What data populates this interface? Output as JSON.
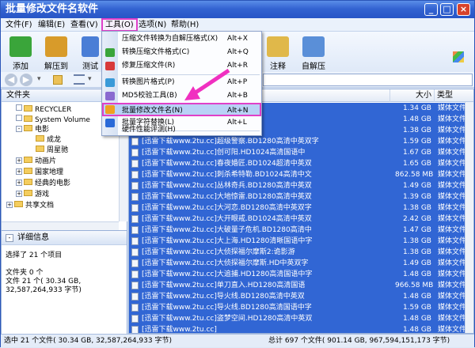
{
  "window": {
    "title": "批量修改文件名软件",
    "min_glyph": "_",
    "max_glyph": "□",
    "close_glyph": "×"
  },
  "menubar": {
    "items": [
      "文件(F)",
      "编辑(E)",
      "查看(V)",
      "工具(O)",
      "选项(N)",
      "帮助(H)"
    ]
  },
  "toolbar": {
    "buttons": [
      {
        "label": "添加",
        "icon": "add-archive-icon",
        "color": "#3aa53a"
      },
      {
        "label": "解压到",
        "icon": "extract-to-icon",
        "color": "#d89b2a"
      },
      {
        "label": "测试",
        "icon": "test-icon",
        "color": "#4a7ed6"
      },
      {
        "label": "注释",
        "icon": "comment-icon",
        "color": "#e0b84a"
      },
      {
        "label": "自解压",
        "icon": "sfx-icon",
        "color": "#5a8fd8"
      }
    ]
  },
  "navbar": {
    "back_icon": "back-arrow-icon",
    "forward_icon": "forward-arrow-icon"
  },
  "left_panel": {
    "title": "文件夹",
    "tree": [
      {
        "label": "RECYCLER",
        "expander": "",
        "depth": 2
      },
      {
        "label": "System Volume",
        "expander": "",
        "depth": 2
      },
      {
        "label": "电影",
        "expander": "-",
        "depth": 2
      },
      {
        "label": "成龙",
        "expander": "",
        "depth": 3
      },
      {
        "label": "周星驰",
        "expander": "",
        "depth": 3
      },
      {
        "label": "动画片",
        "expander": "+",
        "depth": 2
      },
      {
        "label": "国家地理",
        "expander": "+",
        "depth": 2
      },
      {
        "label": "经典的电影",
        "expander": "+",
        "depth": 2
      },
      {
        "label": "游戏",
        "expander": "+",
        "depth": 2
      },
      {
        "label": "共享文档",
        "expander": "+",
        "depth": 1
      }
    ],
    "detail_title": "详细信息",
    "detail_lines": [
      "选择了 21 个项目",
      "文件夹 0 个",
      "文件 21 个( 30.34 GB,",
      "32,587,264,933 字节)"
    ]
  },
  "file_list": {
    "columns": [
      "名称",
      "大小",
      "类型"
    ],
    "rows": [
      {
        "name": "",
        "size": "1.34 GB",
        "type": "媒体文件 (.rmvb)"
      },
      {
        "name": "",
        "size": "1.48 GB",
        "type": "媒体文件 (.rmvb)"
      },
      {
        "name": "",
        "size": "1.38 GB",
        "type": "媒体文件 (.rmvb)"
      },
      {
        "name": "[迅雷下载www.2tu.cc]超级警察.BD1280高清中英双字",
        "size": "1.59 GB",
        "type": "媒体文件 (.rmvb)"
      },
      {
        "name": "[迅雷下载www.2tu.cc]创可阳.HD1024高清国语中",
        "size": "1.67 GB",
        "type": "媒体文件 (.mkv)"
      },
      {
        "name": "[迅雷下载www.2tu.cc]春夜婚匠.BD1024超清中英双",
        "size": "1.65 GB",
        "type": "媒体文件 (.mkv)"
      },
      {
        "name": "[迅雷下载www.2tu.cc]刺杀希特勒.BD1024高清中文",
        "size": "862.58 MB",
        "type": "媒体文件 (.rmvb)"
      },
      {
        "name": "[迅雷下载www.2tu.cc]丛林奇兵.BD1280高清中英双",
        "size": "1.49 GB",
        "type": "媒体文件 (.rmvb)"
      },
      {
        "name": "[迅雷下载www.2tu.cc]大地惊雷.BD1280高清中英双",
        "size": "1.39 GB",
        "type": "媒体文件 (.rmvb)"
      },
      {
        "name": "[迅雷下载www.2tu.cc]大河恋.BD1280高清中英双字",
        "size": "1.38 GB",
        "type": "媒体文件 (.rmvb)"
      },
      {
        "name": "[迅雷下载www.2tu.cc]大开眼戒.BD1024高清中英双",
        "size": "2.42 GB",
        "type": "媒体文件 (.mkv)"
      },
      {
        "name": "[迅雷下载www.2tu.cc]大破量子危机.BD1280高清中",
        "size": "1.47 GB",
        "type": "媒体文件 (.rmvb)"
      },
      {
        "name": "[迅雷下载www.2tu.cc]大上海.HD1280清晰国语中字",
        "size": "1.38 GB",
        "type": "媒体文件 (.rmvb)"
      },
      {
        "name": "[迅雷下载www.2tu.cc]大侦探福尔摩斯2:诡影游",
        "size": "1.38 GB",
        "type": "媒体文件 (.rmvb)"
      },
      {
        "name": "[迅雷下载www.2tu.cc]大侦探福尔摩斯.HD中英双字",
        "size": "1.49 GB",
        "type": "媒体文件 (.rmvb)"
      },
      {
        "name": "[迅雷下载www.2tu.cc]大追捕.HD1280高清国语中字",
        "size": "1.48 GB",
        "type": "媒体文件 (.rmvb)"
      },
      {
        "name": "[迅雷下载www.2tu.cc]单刀直入.HD1280高清国语",
        "size": "966.58 MB",
        "type": "媒体文件 (.rmvb)"
      },
      {
        "name": "[迅雷下载www.2tu.cc]导火线.BD1280高清中英双",
        "size": "1.48 GB",
        "type": "媒体文件 (.rmvb)"
      },
      {
        "name": "[迅雷下载www.2tu.cc]导火线.BD1280高清国语中字",
        "size": "1.59 GB",
        "type": "媒体文件 (.rmvb)"
      },
      {
        "name": "[迅雷下载www.2tu.cc]盗梦空间.HD1280高清中英双",
        "size": "1.48 GB",
        "type": "媒体文件 (.rmvb)"
      },
      {
        "name": "[迅雷下载www.2tu.cc]",
        "size": "1.48 GB",
        "type": "媒体文件 (.rmvb)"
      }
    ]
  },
  "tools_menu": {
    "items": [
      {
        "label": "压缩文件转换为自解压格式(X)",
        "shortcut": "Alt+X",
        "icon": "sfx-convert-icon",
        "color": "#4f86d8"
      },
      {
        "label": "转换压缩文件格式(C)",
        "shortcut": "Alt+Q",
        "icon": "convert-archive-icon",
        "color": "#3aa53a"
      },
      {
        "label": "修复压缩文件(R)",
        "shortcut": "Alt+R",
        "icon": "repair-icon",
        "color": "#d83a3a"
      },
      {
        "label": "转换图片格式(P)",
        "shortcut": "Alt+P",
        "icon": "image-convert-icon",
        "color": "#3a9ad8"
      },
      {
        "label": "MD5校验工具(B)",
        "shortcut": "Alt+B",
        "icon": "md5-icon",
        "color": "#8a6ad0"
      },
      {
        "label": "批量修改文件名(N)",
        "shortcut": "Alt+N",
        "icon": "rename-icon",
        "color": "#f0a020"
      },
      {
        "label": "批量字符替换(L)",
        "shortcut": "Alt+L",
        "icon": "replace-icon",
        "color": "#2a6ad8"
      },
      {
        "label": "硬件性能评测(H)",
        "shortcut": "",
        "icon": "",
        "color": ""
      }
    ]
  },
  "statusbar": {
    "left": "选中 21 个文件( 30.34 GB, 32,587,264,933 字节)",
    "right": "总计 697 个文件( 901.14 GB, 967,594,151,173 字节)"
  },
  "colors": {
    "selection": "#3166d4",
    "highlight_border": "#e040c8",
    "arrow": "#f030c0"
  }
}
